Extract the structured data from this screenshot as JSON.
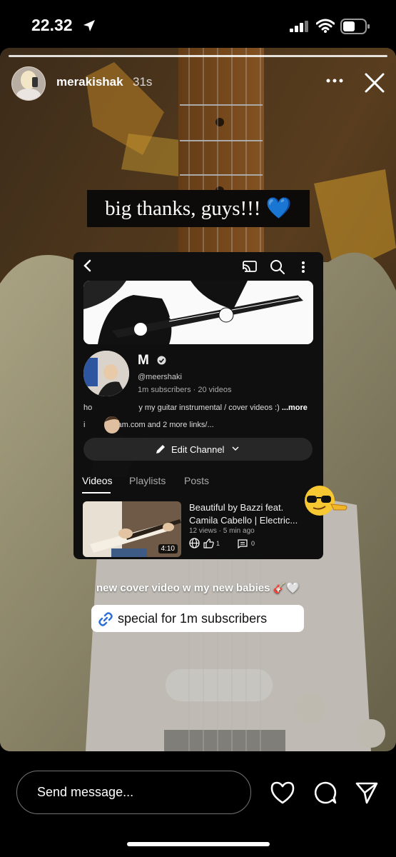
{
  "status": {
    "time": "22.32"
  },
  "story": {
    "username": "merakishak",
    "time_ago": "31s",
    "caption": "big thanks, guys!!! 💙",
    "caption2": "new cover video w my new babies 🎸🤍",
    "link_label": "special for 1m subscribers",
    "emoji": "😎",
    "icons": [
      "location-arrow-icon",
      "signal-icon",
      "wifi-icon",
      "battery-icon",
      "more-icon",
      "close-icon",
      "link-icon"
    ]
  },
  "youtube": {
    "channel_name": "M",
    "handle": "@meershaki",
    "stats": "1m subscribers · 20 videos",
    "description_start": "ho",
    "description_end": "y my guitar instrumental / cover videos :) ",
    "description_more": "...more",
    "links_start": "i",
    "links_end": "am.com and 2 more links/...",
    "edit_label": "Edit Channel",
    "tabs": [
      {
        "label": "Videos",
        "active": true
      },
      {
        "label": "Playlists",
        "active": false
      },
      {
        "label": "Posts",
        "active": false
      }
    ],
    "video": {
      "title": "Beautiful by Bazzi feat. Camila Cabello | Electric...",
      "meta": "12 views · 5 min ago",
      "duration": "4:10",
      "likes": "1",
      "comments": "0"
    }
  },
  "footer": {
    "send_placeholder": "Send message..."
  }
}
